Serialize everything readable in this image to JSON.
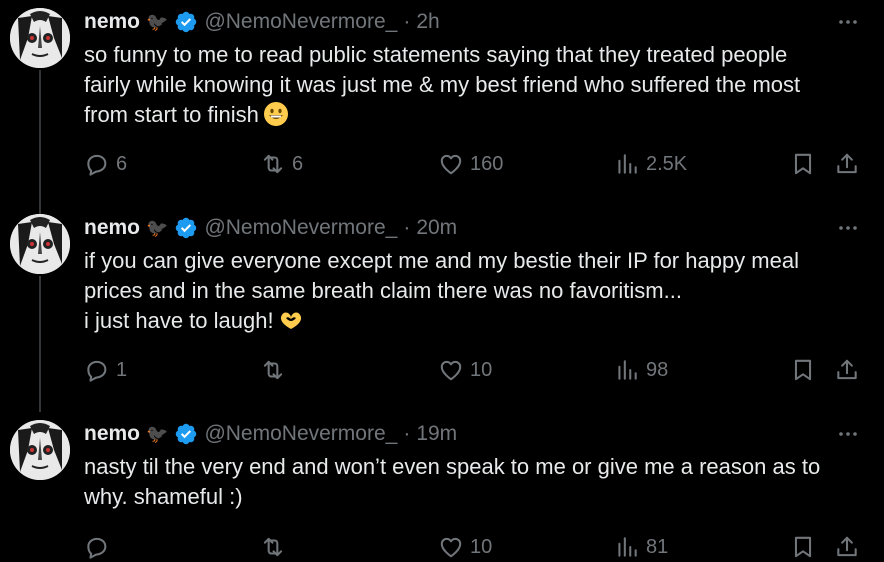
{
  "tweets": [
    {
      "name": "nemo",
      "emoji_badge": "🐦‍⬛",
      "handle": "@NemoNevermore_",
      "dot": "·",
      "time": "2h",
      "text_lines": [
        "so funny to me to read public statements saying that they treated people",
        "fairly while knowing it was just me & my best friend who suffered the most",
        "from start to finish"
      ],
      "trailing_emoji": "grinning-face",
      "replies": "6",
      "reposts": "6",
      "likes": "160",
      "views": "2.5K"
    },
    {
      "name": "nemo",
      "emoji_badge": "🐦‍⬛",
      "handle": "@NemoNevermore_",
      "dot": "·",
      "time": "20m",
      "text_lines": [
        "if you can give everyone except me and my bestie their IP for happy meal",
        "prices and in the same breath claim there was no favoritism...",
        "i just have to laugh!"
      ],
      "trailing_emoji": "heart-hands",
      "replies": "1",
      "reposts": "",
      "likes": "10",
      "views": "98"
    },
    {
      "name": "nemo",
      "emoji_badge": "🐦‍⬛",
      "handle": "@NemoNevermore_",
      "dot": "·",
      "time": "19m",
      "text_lines": [
        "nasty til the very end and won’t even speak to me or give me a reason as to",
        "why. shameful :)"
      ],
      "trailing_emoji": "",
      "replies": "",
      "reposts": "",
      "likes": "10",
      "views": "81"
    }
  ],
  "colors": {
    "background": "#000000",
    "text": "#e7e9ea",
    "muted": "#71767b",
    "verified": "#1d9bf0",
    "thread_line": "#333639"
  }
}
